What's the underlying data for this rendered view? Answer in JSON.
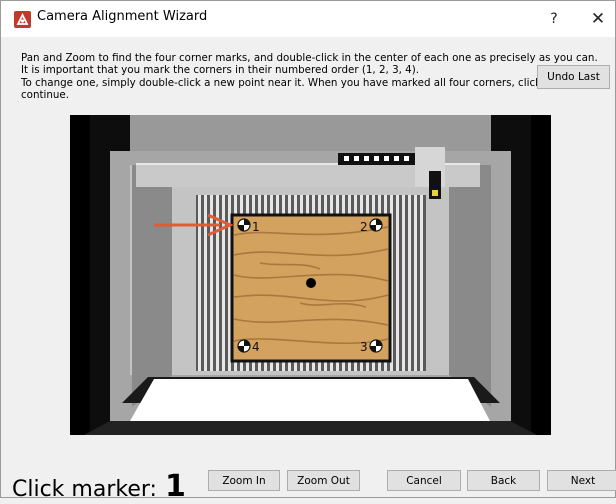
{
  "window": {
    "title": "Camera Alignment Wizard",
    "help_label": "?",
    "close_label": "✕",
    "icon": "wizard-app-icon"
  },
  "instructions": {
    "line1": "Pan and Zoom to find the four corner marks, and double-click in the center of each one as precisely as you can.",
    "line2": "It is important that you mark the corners in their numbered order (1, 2, 3, 4).",
    "line3": "To change one, simply double-click a new point near it.  When you have marked all four corners, click Next to",
    "line4": "continue."
  },
  "toolbar": {
    "undo_label": "Undo Last"
  },
  "viewer": {
    "corner_marks": [
      "1",
      "2",
      "3",
      "4"
    ],
    "pointer_icon": "arrow-right-icon"
  },
  "footer": {
    "click_marker_label": "Click marker:",
    "click_marker_number": "1",
    "zoom_in_label": "Zoom In",
    "zoom_out_label": "Zoom Out",
    "cancel_label": "Cancel",
    "back_label": "Back",
    "next_label": "Next"
  },
  "colors": {
    "arrow": "#e35a37",
    "wood": "#d3a25f",
    "app_icon": "#c0392b"
  }
}
